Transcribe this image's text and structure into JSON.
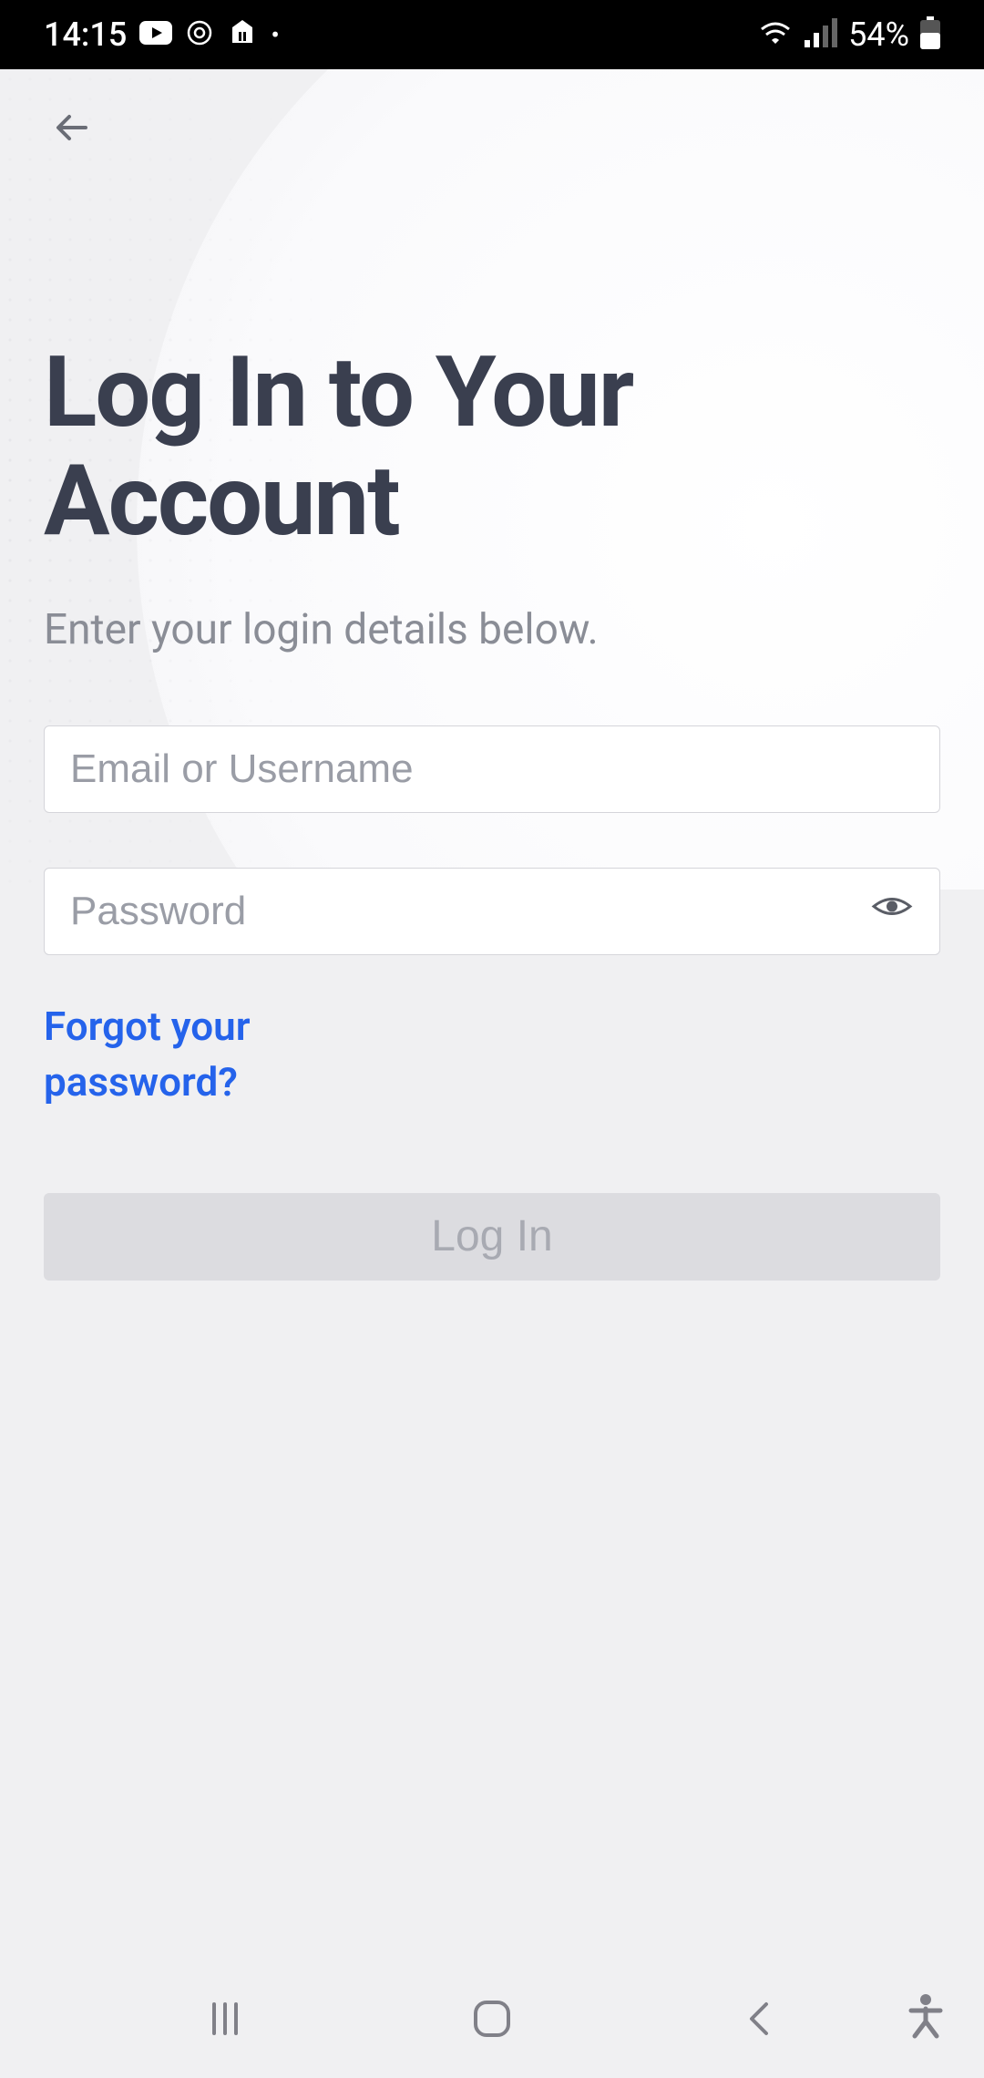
{
  "statusBar": {
    "time": "14:15",
    "batteryPercent": "54%"
  },
  "page": {
    "title": "Log In to Your Account",
    "subtitle": "Enter your login details below."
  },
  "form": {
    "emailPlaceholder": "Email or Username",
    "passwordPlaceholder": "Password",
    "forgotPassword": "Forgot your password?",
    "loginButton": "Log In"
  }
}
